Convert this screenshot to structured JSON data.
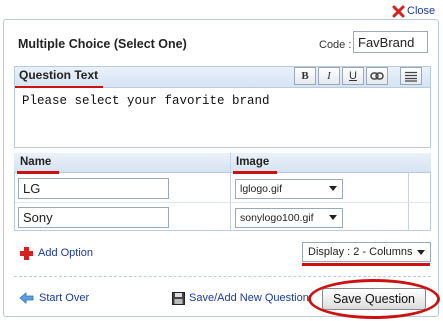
{
  "header": {
    "close_label": "Close"
  },
  "question": {
    "title": "Multiple Choice (Select One)",
    "code_label": "Code :",
    "code_value": "FavBrand",
    "text_label": "Question Text",
    "text_value": "Please select your favorite brand",
    "toolbar": {
      "bold": "B",
      "italic": "I",
      "underline": "U"
    }
  },
  "options": {
    "columns": {
      "name": "Name",
      "image": "Image"
    },
    "rows": [
      {
        "name": "LG",
        "image": "lglogo.gif"
      },
      {
        "name": "Sony",
        "image": "sonylogo100.gif"
      }
    ],
    "add_label": "Add Option"
  },
  "display": {
    "value": "Display : 2 - Columns"
  },
  "footer": {
    "start_over_label": "Start Over",
    "save_add_label": "Save/Add New Question",
    "save_label": "Save Question"
  },
  "colors": {
    "accent_red": "#cc1111",
    "link_blue": "#1a3a9c",
    "header_bg": "#d6e3f2"
  }
}
